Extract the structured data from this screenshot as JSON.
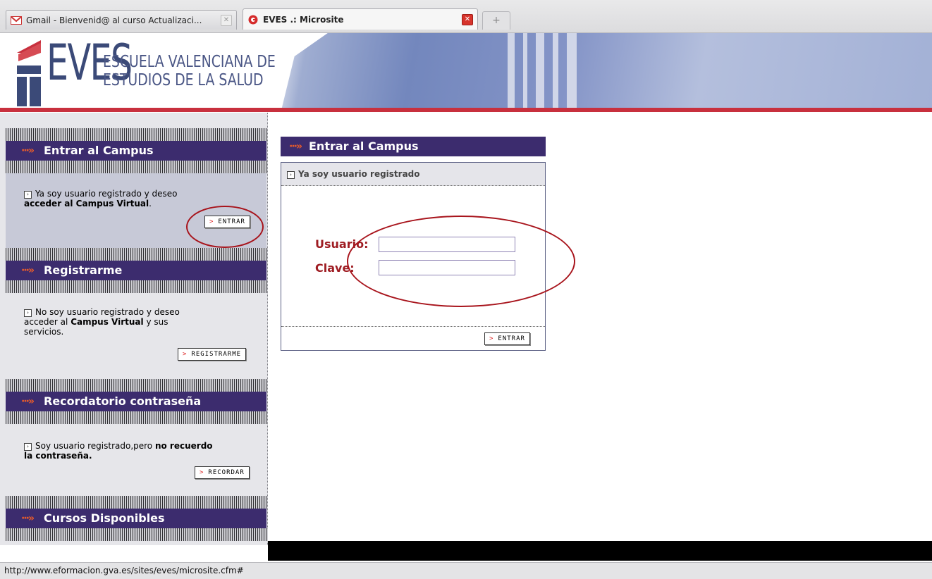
{
  "browser": {
    "tabs": [
      {
        "label": "Gmail - Bienvenid@ al curso Actualizaci...",
        "active": false
      },
      {
        "label": "EVES .: Microsite",
        "active": true
      }
    ],
    "new_tab": "+",
    "status_url": "http://www.eformacion.gva.es/sites/eves/microsite.cfm#"
  },
  "header": {
    "logo_text": "EVES",
    "logo_sub_line1": "ESCUELA VALENCIANA DE",
    "logo_sub_line2": "ESTUDIOS DE LA SALUD"
  },
  "sidebar": {
    "sections": [
      {
        "title": "Entrar al Campus",
        "text_plain": "Ya soy usuario registrado y deseo",
        "text_bold": "acceder al Campus Virtual",
        "text_after": ".",
        "button": "ENTRAR"
      },
      {
        "title": "Registrarme",
        "text_plain": "No soy usuario registrado y deseo",
        "text_line2_pre": "acceder al ",
        "text_bold": "Campus Virtual",
        "text_line2_post": " y sus",
        "text_line3": "servicios.",
        "button": "REGISTRARME"
      },
      {
        "title": "Recordatorio contraseña",
        "text_plain": "Soy usuario registrado,pero ",
        "text_bold": "no recuerdo",
        "text_bold2": "la contraseña.",
        "button": "RECORDAR"
      },
      {
        "title": "Cursos Disponibles"
      }
    ]
  },
  "login": {
    "title": "Entrar al Campus",
    "subtitle": "Ya soy usuario registrado",
    "user_label": "Usuario:",
    "pass_label": "Clave:",
    "user_value": "",
    "pass_value": "",
    "submit": "ENTRAR"
  },
  "colors": {
    "header_purple": "#3c2c6e",
    "accent_red": "#c8303e",
    "label_red": "#9e1c22",
    "annotation_red": "#a8141c"
  }
}
